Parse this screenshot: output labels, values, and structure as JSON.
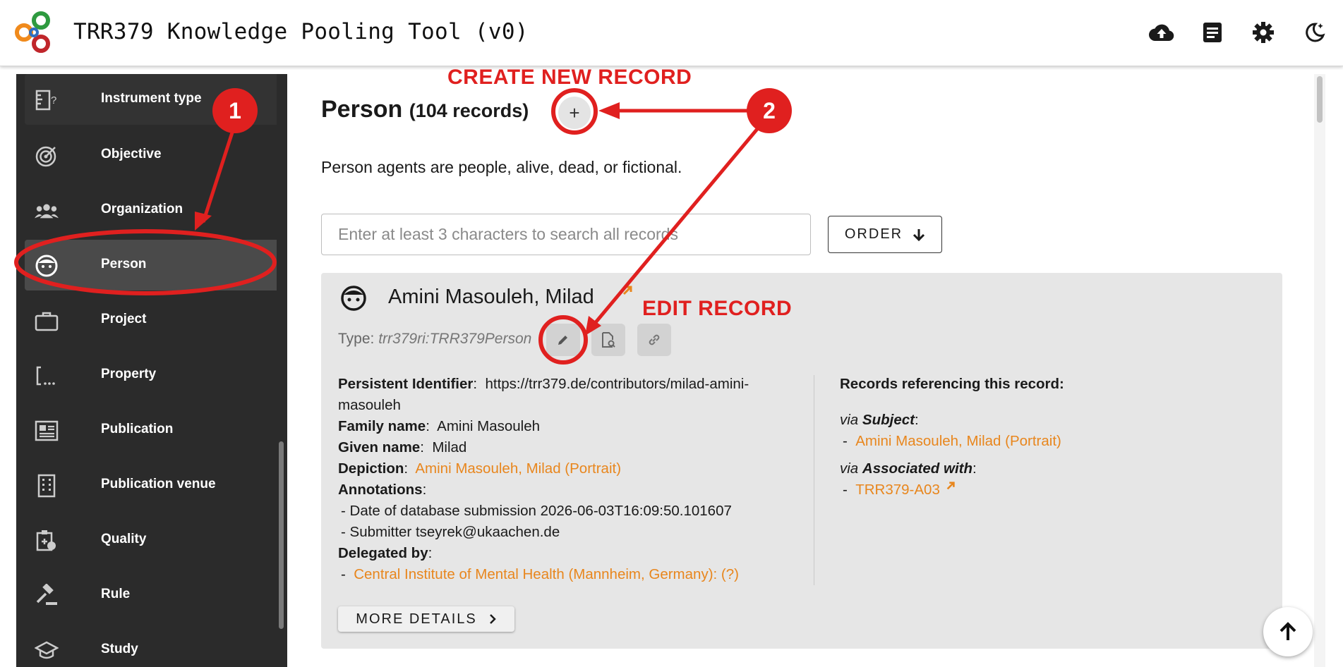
{
  "header": {
    "title": "TRR379 Knowledge Pooling Tool (v0)",
    "icons": [
      "cloud-upload-icon",
      "document-icon",
      "gear-icon",
      "dark-mode-icon"
    ]
  },
  "sidebar": {
    "items": [
      {
        "label": "Instrument type",
        "icon": "instrument-icon"
      },
      {
        "label": "Objective",
        "icon": "target-icon"
      },
      {
        "label": "Organization",
        "icon": "group-icon"
      },
      {
        "label": "Person",
        "icon": "face-icon"
      },
      {
        "label": "Project",
        "icon": "briefcase-icon"
      },
      {
        "label": "Property",
        "icon": "property-icon"
      },
      {
        "label": "Publication",
        "icon": "newspaper-icon"
      },
      {
        "label": "Publication venue",
        "icon": "building-icon"
      },
      {
        "label": "Quality",
        "icon": "quality-icon"
      },
      {
        "label": "Rule",
        "icon": "gavel-icon"
      },
      {
        "label": "Study",
        "icon": "school-icon"
      }
    ],
    "active": "Person"
  },
  "main": {
    "title": "Person",
    "count": "(104 records)",
    "add_symbol": "+",
    "description": "Person agents are people, alive, dead, or fictional.",
    "search_placeholder": "Enter at least 3 characters to search all records",
    "order_label": "ORDER"
  },
  "record": {
    "name": "Amini Masouleh, Milad",
    "type_label": "Type:",
    "type_value": "trr379ri:TRR379Person",
    "fields": {
      "pid_label": "Persistent Identifier",
      "pid_value": "https://trr379.de/contributors/milad-amini-masouleh",
      "family_label": "Family name",
      "family_value": "Amini Masouleh",
      "given_label": "Given name",
      "given_value": "Milad",
      "depiction_label": "Depiction",
      "depiction_value": "Amini Masouleh, Milad (Portrait)",
      "annotations_label": "Annotations",
      "annotation_1": "- Date of database submission 2026-06-03T16:09:50.101607",
      "annotation_2": "- Submitter tseyrek@ukaachen.de",
      "delegated_label": "Delegated by",
      "delegated_value": "Central Institute of Mental Health (Mannheim, Germany): (?)"
    },
    "references": {
      "heading": "Records referencing this record:",
      "via_subject_prefix": "via",
      "via_subject": "Subject",
      "subject_link": "Amini Masouleh, Milad (Portrait)",
      "via_assoc_prefix": "via",
      "via_assoc": "Associated with",
      "assoc_link": "TRR379-A03"
    },
    "more_details_label": "MORE DETAILS"
  },
  "annotations": {
    "create_label": "CREATE NEW RECORD",
    "edit_label": "EDIT RECORD",
    "badge_1": "1",
    "badge_2": "2",
    "color": "#e0201f"
  },
  "colors": {
    "link": "#e8861d",
    "sidebar_bg": "#2b2b2b",
    "card_bg": "#e6e6e6"
  }
}
